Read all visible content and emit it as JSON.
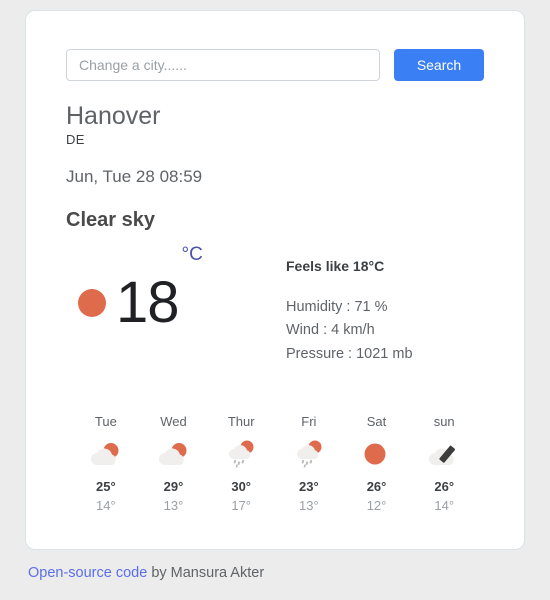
{
  "search": {
    "placeholder": "Change a city......",
    "value": "",
    "button_label": "Search"
  },
  "location": {
    "city": "Hanover",
    "country": "DE",
    "datetime": "Jun, Tue 28 08:59"
  },
  "current": {
    "condition": "Clear sky",
    "icon": "sun-icon",
    "temperature": "18",
    "unit": "°C",
    "feels_like": "Feels like 18°C",
    "humidity": "Humidity : 71 %",
    "wind": "Wind : 4 km/h",
    "pressure": "Pressure : 1021 mb"
  },
  "forecast": [
    {
      "day": "Tue",
      "icon": "sun-behind-cloud-icon",
      "high": "25°",
      "low": "14°"
    },
    {
      "day": "Wed",
      "icon": "sun-behind-cloud-icon",
      "high": "29°",
      "low": "13°"
    },
    {
      "day": "Thur",
      "icon": "sun-behind-rain-cloud-icon",
      "high": "30°",
      "low": "17°"
    },
    {
      "day": "Fri",
      "icon": "sun-behind-rain-cloud-icon",
      "high": "23°",
      "low": "13°"
    },
    {
      "day": "Sat",
      "icon": "sun-icon",
      "high": "26°",
      "low": "12°"
    },
    {
      "day": "sun",
      "icon": "dark-cloud-icon",
      "high": "26°",
      "low": "14°"
    }
  ],
  "footer": {
    "link_text": "Open-source code",
    "credit_text": " by Mansura Akter"
  },
  "colors": {
    "accent_blue": "#3b7ff5",
    "sun_orange": "#DE6B4B",
    "cloud_gray": "#f0efed",
    "dark_cloud": "#3c3c3c",
    "link_blue": "#5b6ee8"
  }
}
